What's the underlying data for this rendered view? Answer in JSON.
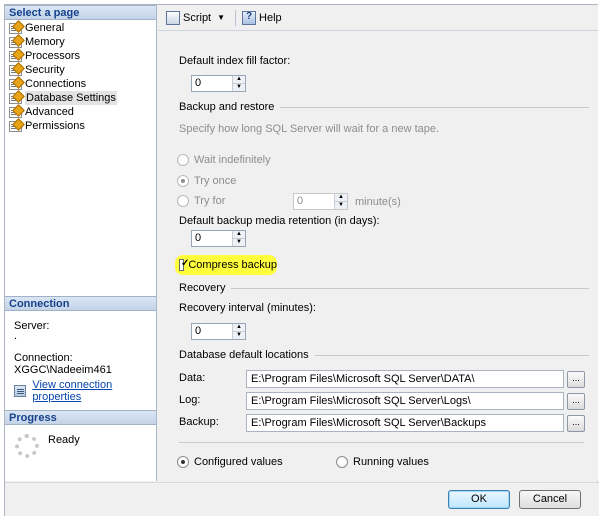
{
  "left_pane": {
    "select_page_title": "Select a page",
    "pages": [
      {
        "label": "General"
      },
      {
        "label": "Memory"
      },
      {
        "label": "Processors"
      },
      {
        "label": "Security"
      },
      {
        "label": "Connections"
      },
      {
        "label": "Database Settings",
        "selected": true
      },
      {
        "label": "Advanced"
      },
      {
        "label": "Permissions"
      }
    ],
    "connection": {
      "title": "Connection",
      "server_label": "Server:",
      "server_value": ".",
      "connection_label": "Connection:",
      "connection_value": "XGGC\\Nadeeim461",
      "view_properties_link": "View connection properties"
    },
    "progress": {
      "title": "Progress",
      "status": "Ready"
    }
  },
  "toolbar": {
    "script_label": "Script",
    "help_label": "Help"
  },
  "settings": {
    "fill_factor_label": "Default index fill factor:",
    "fill_factor_value": "0",
    "backup_restore_header": "Backup and restore",
    "backup_description": "Specify how long SQL Server will wait for a new tape.",
    "wait_indefinitely_label": "Wait indefinitely",
    "try_once_label": "Try once",
    "try_for_label": "Try for",
    "try_for_value": "0",
    "minutes_label": "minute(s)",
    "retention_label": "Default backup media retention (in days):",
    "retention_value": "0",
    "compress_backup_label": "Compress backup",
    "compress_backup_checked": true,
    "recovery_header": "Recovery",
    "recovery_interval_label": "Recovery interval (minutes):",
    "recovery_interval_value": "0",
    "locations_header": "Database default locations",
    "data_label": "Data:",
    "data_path": "E:\\Program Files\\Microsoft SQL Server\\DATA\\",
    "log_label": "Log:",
    "log_path": "E:\\Program Files\\Microsoft SQL Server\\Logs\\",
    "backup_label": "Backup:",
    "backup_path": "E:\\Program Files\\Microsoft SQL Server\\Backups",
    "browse_label": "...",
    "configured_values_label": "Configured values",
    "running_values_label": "Running values"
  },
  "buttons": {
    "ok": "OK",
    "cancel": "Cancel"
  },
  "colors": {
    "highlight": "#ffff3c",
    "link": "#0645ad",
    "header_text": "#15428b"
  }
}
